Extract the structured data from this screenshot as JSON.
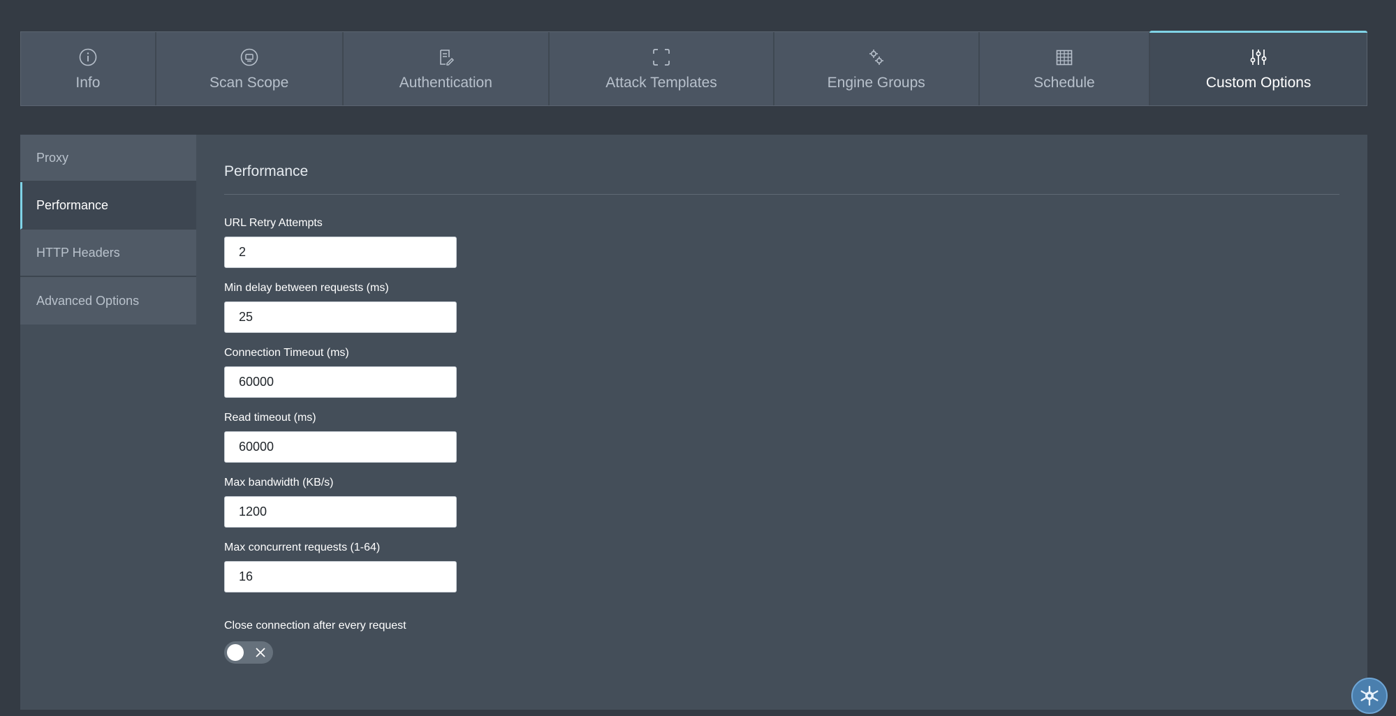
{
  "tabs": [
    {
      "label": "Info",
      "icon": "info-icon"
    },
    {
      "label": "Scan Scope",
      "icon": "scope-icon"
    },
    {
      "label": "Authentication",
      "icon": "document-edit-icon"
    },
    {
      "label": "Attack Templates",
      "icon": "brackets-icon"
    },
    {
      "label": "Engine Groups",
      "icon": "gears-icon"
    },
    {
      "label": "Schedule",
      "icon": "calendar-icon"
    },
    {
      "label": "Custom Options",
      "icon": "sliders-icon",
      "active": true
    }
  ],
  "sidebar": {
    "items": [
      {
        "label": "Proxy"
      },
      {
        "label": "Performance",
        "active": true
      },
      {
        "label": "HTTP Headers"
      },
      {
        "label": "Advanced Options"
      }
    ]
  },
  "panel": {
    "title": "Performance",
    "fields": [
      {
        "label": "URL Retry Attempts",
        "value": "2"
      },
      {
        "label": "Min delay between requests (ms)",
        "value": "25"
      },
      {
        "label": "Connection Timeout (ms)",
        "value": "60000"
      },
      {
        "label": "Read timeout (ms)",
        "value": "60000"
      },
      {
        "label": "Max bandwidth (KB/s)",
        "value": "1200"
      },
      {
        "label": "Max concurrent requests (1-64)",
        "value": "16"
      }
    ],
    "toggle": {
      "label": "Close connection after every request",
      "state": "off"
    }
  },
  "colors": {
    "background": "#343b44",
    "accent": "#7fd3e6",
    "fab": "#4a7fae"
  }
}
